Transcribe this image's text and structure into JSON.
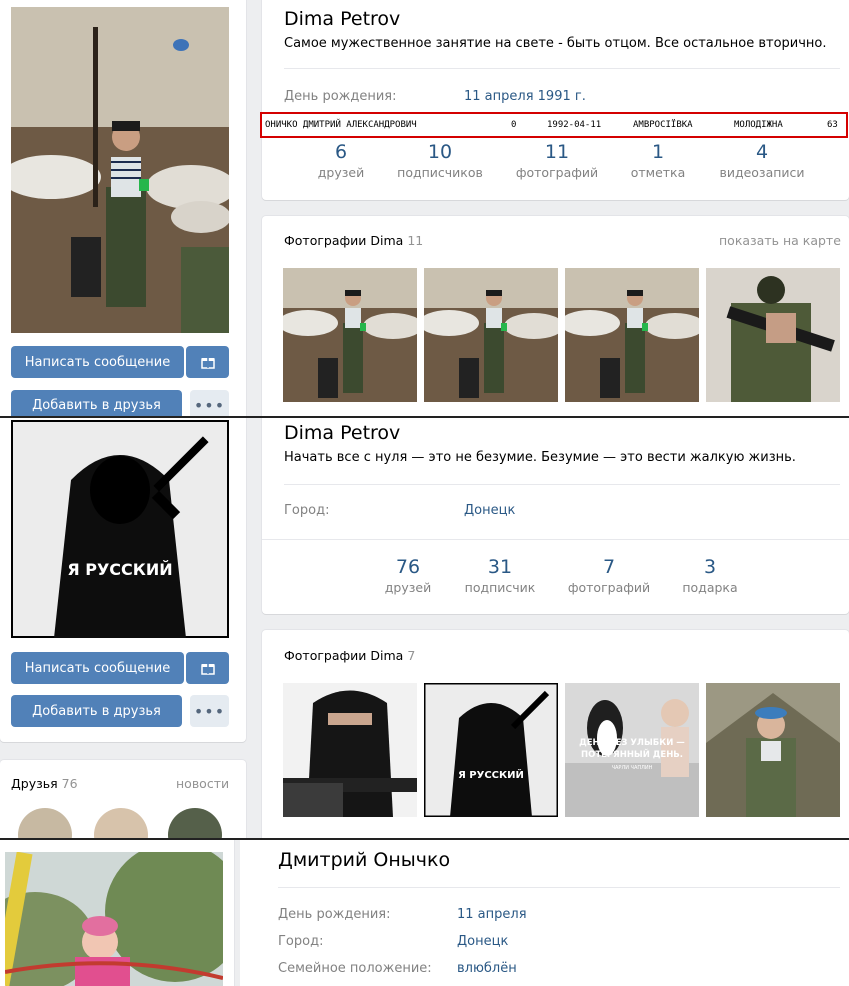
{
  "p1": {
    "name": "Dima Petrov",
    "status": "Самое мужественное занятие на свете - быть отцом. Все остальное вторично.",
    "birthday_label": "День рождения:",
    "birthday_value": "11 апреля 1991 г.",
    "db_row": {
      "fio": "ОНИЧКО ДМИТРИЙ АЛЕКСАНДРОВИЧ",
      "code": "0",
      "date": "1992-04-11",
      "city": "АМВРОСІЇВКА",
      "street": "МОЛОДІЖНА",
      "house": "63"
    },
    "counters": [
      {
        "num": "6",
        "label": "друзей"
      },
      {
        "num": "10",
        "label": "подписчиков"
      },
      {
        "num": "11",
        "label": "фотографий"
      },
      {
        "num": "1",
        "label": "отметка"
      },
      {
        "num": "4",
        "label": "видеозаписи"
      }
    ],
    "photos_title": "Фотографии Dima",
    "photos_count": "11",
    "map_link": "показать на карте",
    "btn_message": "Написать сообщение",
    "btn_add": "Добавить в друзья"
  },
  "p2": {
    "name": "Dima Petrov",
    "status": "Начать все с нуля — это не безумие. Безумие — это вести жалкую жизнь.",
    "city_label": "Город:",
    "city_value": "Донецк",
    "counters": [
      {
        "num": "76",
        "label": "друзей"
      },
      {
        "num": "31",
        "label": "подписчик"
      },
      {
        "num": "7",
        "label": "фотографий"
      },
      {
        "num": "3",
        "label": "подарка"
      }
    ],
    "photos_title": "Фотографии Dima",
    "photos_count": "7",
    "btn_message": "Написать сообщение",
    "btn_add": "Добавить в друзья",
    "friends_title": "Друзья",
    "friends_count": "76",
    "news_link": "новости",
    "avatar_text": "Я РУССКИЙ",
    "poster_text_1": "ДЕНЬ БЕЗ УЛЫБКИ —",
    "poster_text_2": "ПОТЕРЯННЫЙ ДЕНЬ.",
    "poster_author": "ЧАРЛИ ЧАПЛИН"
  },
  "p3": {
    "name": "Дмитрий Онычко",
    "rows": [
      {
        "label": "День рождения:",
        "value": "11 апреля"
      },
      {
        "label": "Город:",
        "value": "Донецк"
      },
      {
        "label": "Семейное положение:",
        "value": "влюблён"
      }
    ]
  },
  "colors": {
    "accent": "#5181b8",
    "link": "#2a5885",
    "muted": "#828282",
    "highlight": "#d40000"
  }
}
